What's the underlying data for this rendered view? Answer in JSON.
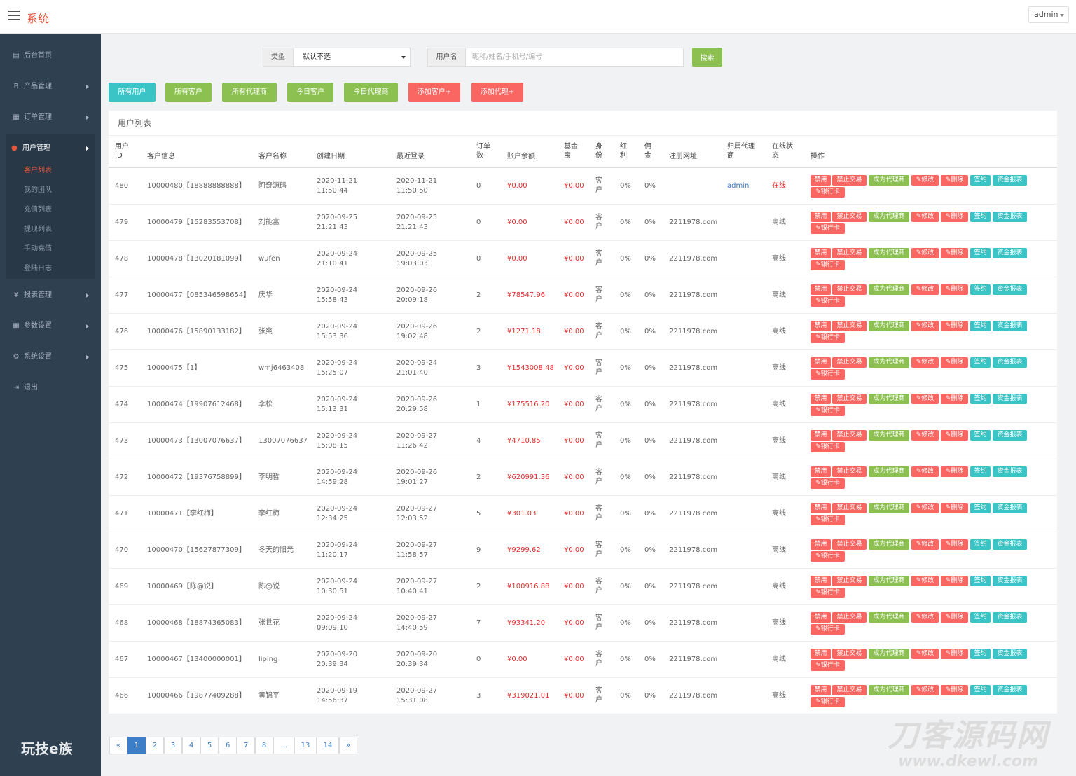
{
  "app": {
    "title": "系统",
    "user": "admin"
  },
  "sidebar": {
    "items": [
      {
        "icon": "dashboard-icon",
        "glyph": "▤",
        "label": "后台首页",
        "has_arrow": false
      },
      {
        "icon": "bitcoin-icon",
        "glyph": "B",
        "label": "产品管理",
        "has_arrow": true
      },
      {
        "icon": "orders-icon",
        "glyph": "▦",
        "label": "订单管理",
        "has_arrow": true
      }
    ],
    "active": {
      "icon": "user-icon",
      "glyph": "●",
      "label": "用户管理"
    },
    "subitems": [
      "客户列表",
      "我的团队",
      "充值列表",
      "提现列表",
      "手动充值",
      "登陆日志"
    ],
    "active_subitem": 0,
    "items_after": [
      {
        "icon": "yen-icon",
        "glyph": "¥",
        "label": "报表管理",
        "has_arrow": true
      },
      {
        "icon": "params-icon",
        "glyph": "▦",
        "label": "参数设置",
        "has_arrow": true
      },
      {
        "icon": "gears-icon",
        "glyph": "⚙",
        "label": "系统设置",
        "has_arrow": true
      },
      {
        "icon": "logout-icon",
        "glyph": "⇥",
        "label": "退出",
        "has_arrow": false
      }
    ],
    "bottom_logo": "玩技e族"
  },
  "filter": {
    "type_label": "类型",
    "type_value": "默认不选",
    "user_label": "用户名",
    "user_placeholder": "昵称/姓名/手机号/编号",
    "search_label": "搜索"
  },
  "toolbar": [
    {
      "label": "所有用户",
      "color": "#3bc4c6"
    },
    {
      "label": "所有客户",
      "color": "#8cc152"
    },
    {
      "label": "所有代理商",
      "color": "#8cc152"
    },
    {
      "label": "今日客户",
      "color": "#8cc152"
    },
    {
      "label": "今日代理商",
      "color": "#8cc152"
    },
    {
      "label": "添加客户+",
      "color": "#fa6661"
    },
    {
      "label": "添加代理+",
      "color": "#fa6661"
    }
  ],
  "panel_title": "用户列表",
  "table": {
    "columns": [
      "用户ID",
      "客户信息",
      "客户名称",
      "创建日期",
      "最近登录",
      "订单数",
      "账户余额",
      "基金宝",
      "身份",
      "红利",
      "佣金",
      "注册网址",
      "归属代理商",
      "在线状态",
      "操作"
    ],
    "actions": [
      {
        "label": "禁用",
        "style": "r"
      },
      {
        "label": "禁止交易",
        "style": "r"
      },
      {
        "label": "成为代理商",
        "style": "g"
      },
      {
        "label": "✎修改",
        "style": "r"
      },
      {
        "label": "✎删除",
        "style": "r"
      },
      {
        "label": "签约",
        "style": "c"
      },
      {
        "label": "资金报表",
        "style": "c"
      },
      {
        "label": "✎银行卡",
        "style": "r"
      }
    ],
    "rows": [
      {
        "id": "480",
        "info": "10000480【18888888888】",
        "name": "阿奇源码",
        "created_date": "2020-11-21",
        "created_time": "11:50:44",
        "login_date": "2020-11-21",
        "login_time": "11:50:50",
        "orders": "0",
        "balance": "¥0.00",
        "fund": "¥0.00",
        "role": "客户",
        "bonus": "0%",
        "commission": "0%",
        "site": "",
        "agent": "admin",
        "status": "在线",
        "online": true
      },
      {
        "id": "479",
        "info": "10000479【15283553708】",
        "name": "刘能富",
        "created_date": "2020-09-25",
        "created_time": "21:21:43",
        "login_date": "2020-09-25",
        "login_time": "21:21:43",
        "orders": "0",
        "balance": "¥0.00",
        "fund": "¥0.00",
        "role": "客户",
        "bonus": "0%",
        "commission": "0%",
        "site": "2211978.com",
        "agent": "",
        "status": "离线",
        "online": false
      },
      {
        "id": "478",
        "info": "10000478【13020181099】",
        "name": "wufen",
        "created_date": "2020-09-24",
        "created_time": "21:10:41",
        "login_date": "2020-09-25",
        "login_time": "19:03:03",
        "orders": "0",
        "balance": "¥0.00",
        "fund": "¥0.00",
        "role": "客户",
        "bonus": "0%",
        "commission": "0%",
        "site": "2211978.com",
        "agent": "",
        "status": "离线",
        "online": false
      },
      {
        "id": "477",
        "info": "10000477【085346598654】",
        "name": "庆华",
        "created_date": "2020-09-24",
        "created_time": "15:58:43",
        "login_date": "2020-09-26",
        "login_time": "20:09:18",
        "orders": "2",
        "balance": "¥78547.96",
        "fund": "¥0.00",
        "role": "客户",
        "bonus": "0%",
        "commission": "0%",
        "site": "2211978.com",
        "agent": "",
        "status": "离线",
        "online": false
      },
      {
        "id": "476",
        "info": "10000476【15890133182】",
        "name": "张爽",
        "created_date": "2020-09-24",
        "created_time": "15:53:36",
        "login_date": "2020-09-26",
        "login_time": "19:02:48",
        "orders": "2",
        "balance": "¥1271.18",
        "fund": "¥0.00",
        "role": "客户",
        "bonus": "0%",
        "commission": "0%",
        "site": "2211978.com",
        "agent": "",
        "status": "离线",
        "online": false
      },
      {
        "id": "475",
        "info": "10000475【1】",
        "name": "wmj6463408",
        "created_date": "2020-09-24",
        "created_time": "15:25:07",
        "login_date": "2020-09-24",
        "login_time": "21:01:40",
        "orders": "3",
        "balance": "¥1543008.48",
        "fund": "¥0.00",
        "role": "客户",
        "bonus": "0%",
        "commission": "0%",
        "site": "2211978.com",
        "agent": "",
        "status": "离线",
        "online": false
      },
      {
        "id": "474",
        "info": "10000474【19907612468】",
        "name": "李松",
        "created_date": "2020-09-24",
        "created_time": "15:13:31",
        "login_date": "2020-09-26",
        "login_time": "20:29:58",
        "orders": "1",
        "balance": "¥175516.20",
        "fund": "¥0.00",
        "role": "客户",
        "bonus": "0%",
        "commission": "0%",
        "site": "2211978.com",
        "agent": "",
        "status": "离线",
        "online": false
      },
      {
        "id": "473",
        "info": "10000473【13007076637】",
        "name": "13007076637",
        "created_date": "2020-09-24",
        "created_time": "15:08:15",
        "login_date": "2020-09-27",
        "login_time": "11:26:42",
        "orders": "4",
        "balance": "¥4710.85",
        "fund": "¥0.00",
        "role": "客户",
        "bonus": "0%",
        "commission": "0%",
        "site": "2211978.com",
        "agent": "",
        "status": "离线",
        "online": false
      },
      {
        "id": "472",
        "info": "10000472【19376758899】",
        "name": "李明哲",
        "created_date": "2020-09-24",
        "created_time": "14:59:28",
        "login_date": "2020-09-26",
        "login_time": "19:01:27",
        "orders": "2",
        "balance": "¥620991.36",
        "fund": "¥0.00",
        "role": "客户",
        "bonus": "0%",
        "commission": "0%",
        "site": "2211978.com",
        "agent": "",
        "status": "离线",
        "online": false
      },
      {
        "id": "471",
        "info": "10000471【李红梅】",
        "name": "李红梅",
        "created_date": "2020-09-24",
        "created_time": "12:34:25",
        "login_date": "2020-09-27",
        "login_time": "12:03:52",
        "orders": "5",
        "balance": "¥301.03",
        "fund": "¥0.00",
        "role": "客户",
        "bonus": "0%",
        "commission": "0%",
        "site": "2211978.com",
        "agent": "",
        "status": "离线",
        "online": false
      },
      {
        "id": "470",
        "info": "10000470【15627877309】",
        "name": "冬天的阳光",
        "created_date": "2020-09-24",
        "created_time": "11:20:17",
        "login_date": "2020-09-27",
        "login_time": "11:58:57",
        "orders": "9",
        "balance": "¥9299.62",
        "fund": "¥0.00",
        "role": "客户",
        "bonus": "0%",
        "commission": "0%",
        "site": "2211978.com",
        "agent": "",
        "status": "离线",
        "online": false
      },
      {
        "id": "469",
        "info": "10000469【陈@锐】",
        "name": "陈@锐",
        "created_date": "2020-09-24",
        "created_time": "10:30:51",
        "login_date": "2020-09-27",
        "login_time": "10:40:41",
        "orders": "2",
        "balance": "¥100916.88",
        "fund": "¥0.00",
        "role": "客户",
        "bonus": "0%",
        "commission": "0%",
        "site": "2211978.com",
        "agent": "",
        "status": "离线",
        "online": false
      },
      {
        "id": "468",
        "info": "10000468【18874365083】",
        "name": "张世花",
        "created_date": "2020-09-24",
        "created_time": "09:09:10",
        "login_date": "2020-09-27",
        "login_time": "14:40:59",
        "orders": "7",
        "balance": "¥93341.20",
        "fund": "¥0.00",
        "role": "客户",
        "bonus": "0%",
        "commission": "0%",
        "site": "2211978.com",
        "agent": "",
        "status": "离线",
        "online": false
      },
      {
        "id": "467",
        "info": "10000467【13400000001】",
        "name": "liping",
        "created_date": "2020-09-20",
        "created_time": "20:39:34",
        "login_date": "2020-09-20",
        "login_time": "20:39:34",
        "orders": "0",
        "balance": "¥0.00",
        "fund": "¥0.00",
        "role": "客户",
        "bonus": "0%",
        "commission": "0%",
        "site": "2211978.com",
        "agent": "",
        "status": "离线",
        "online": false
      },
      {
        "id": "466",
        "info": "10000466【19877409288】",
        "name": "黄锦平",
        "created_date": "2020-09-19",
        "created_time": "14:56:37",
        "login_date": "2020-09-27",
        "login_time": "15:31:08",
        "orders": "3",
        "balance": "¥319021.01",
        "fund": "¥0.00",
        "role": "客户",
        "bonus": "0%",
        "commission": "0%",
        "site": "2211978.com",
        "agent": "",
        "status": "离线",
        "online": false
      }
    ]
  },
  "pagination": {
    "prev": "«",
    "pages": [
      "1",
      "2",
      "3",
      "4",
      "5",
      "6",
      "7",
      "8",
      "...",
      "13",
      "14"
    ],
    "next": "»",
    "current": 0
  },
  "watermark": {
    "line1": "刀客源码网",
    "line2": "www.dkewl.com"
  },
  "colors": {
    "accent": "#e9573f",
    "sidebar": "#2f4050",
    "green": "#8cc152",
    "cyan": "#3bc4c6",
    "red": "#fa6661",
    "price_red": "#e52e2e",
    "link_blue": "#3d7ec9"
  }
}
